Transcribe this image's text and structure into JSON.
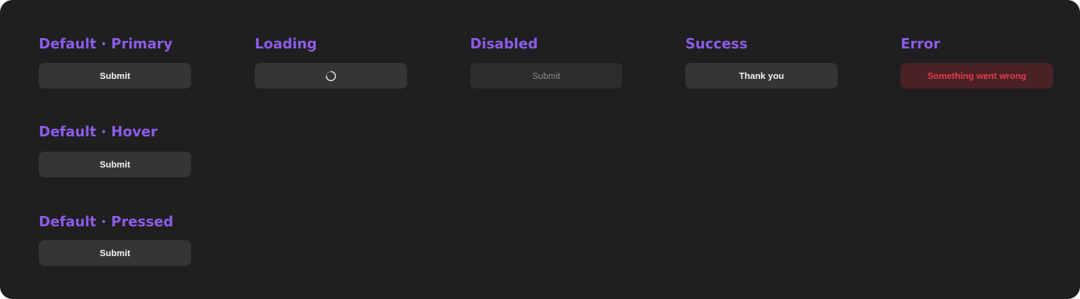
{
  "states": {
    "primary": {
      "heading": "Default · Primary",
      "button_label": "Submit"
    },
    "loading": {
      "heading": "Loading",
      "spinner_icon": "loading-spinner-icon"
    },
    "disabled": {
      "heading": "Disabled",
      "button_label": "Submit"
    },
    "success": {
      "heading": "Success",
      "button_label": "Thank you"
    },
    "error": {
      "heading": "Error",
      "button_label": "Something went wrong"
    },
    "hover": {
      "heading": "Default · Hover",
      "button_label": "Submit"
    },
    "pressed": {
      "heading": "Default · Pressed",
      "button_label": "Submit"
    }
  },
  "colors": {
    "background": "#1f1f1f",
    "heading": "#8e5bea",
    "button": "#353535",
    "button_disabled": "#2c2c2c",
    "button_error_bg": "#4a2127",
    "button_error_text": "#e23b4b"
  }
}
